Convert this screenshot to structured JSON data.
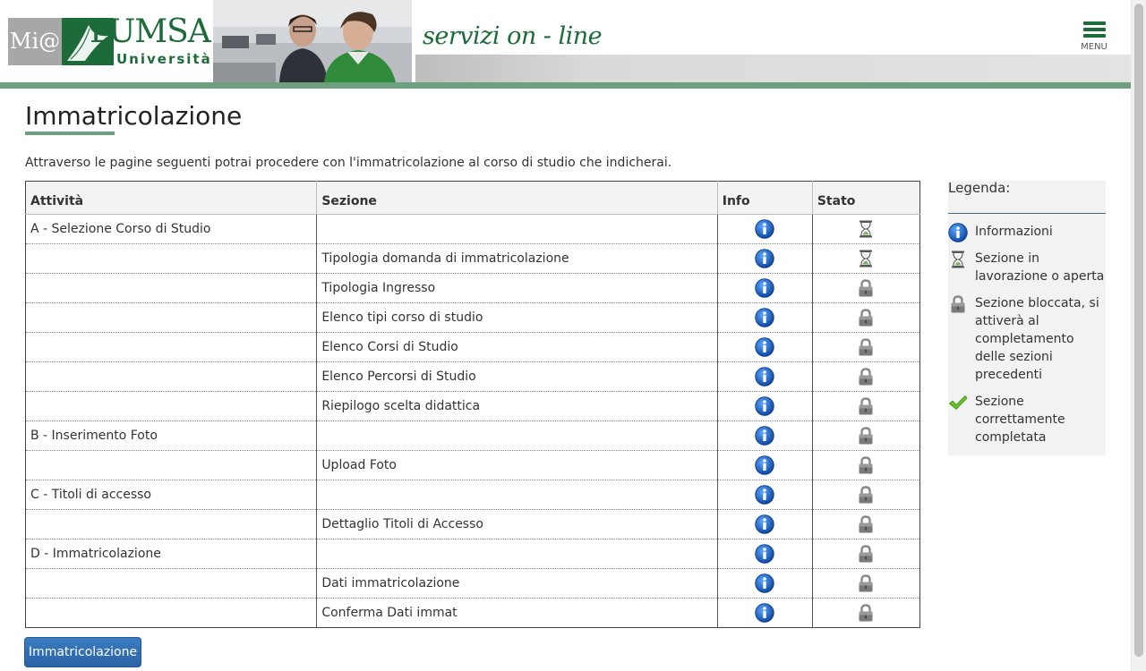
{
  "header": {
    "logo_mi": "Mi@",
    "logo_lumsa": "LUMSA",
    "logo_universita": "Università",
    "tagline": "servizi on - line",
    "menu_label": "MENU"
  },
  "main": {
    "title": "Immatricolazione",
    "intro": "Attraverso le pagine seguenti potrai procedere con l'immatricolazione al corso di studio che indicherai.",
    "table": {
      "headers": [
        "Attività",
        "Sezione",
        "Info",
        "Stato"
      ],
      "rows": [
        {
          "attivita": "A - Selezione Corso di Studio",
          "sezione": "",
          "info": "info-icon",
          "stato": "hourglass"
        },
        {
          "attivita": "",
          "sezione": "Tipologia domanda di immatricolazione",
          "info": "info-icon",
          "stato": "hourglass"
        },
        {
          "attivita": "",
          "sezione": "Tipologia Ingresso",
          "info": "info-icon",
          "stato": "lock"
        },
        {
          "attivita": "",
          "sezione": "Elenco tipi corso di studio",
          "info": "info-icon",
          "stato": "lock"
        },
        {
          "attivita": "",
          "sezione": "Elenco Corsi di Studio",
          "info": "info-icon",
          "stato": "lock"
        },
        {
          "attivita": "",
          "sezione": "Elenco Percorsi di Studio",
          "info": "info-icon",
          "stato": "lock"
        },
        {
          "attivita": "",
          "sezione": "Riepilogo scelta didattica",
          "info": "info-icon",
          "stato": "lock"
        },
        {
          "attivita": "B - Inserimento Foto",
          "sezione": "",
          "info": "info-icon",
          "stato": "lock"
        },
        {
          "attivita": "",
          "sezione": "Upload Foto",
          "info": "info-icon",
          "stato": "lock"
        },
        {
          "attivita": "C - Titoli di accesso",
          "sezione": "",
          "info": "info-icon",
          "stato": "lock"
        },
        {
          "attivita": "",
          "sezione": "Dettaglio Titoli di Accesso",
          "info": "info-icon",
          "stato": "lock"
        },
        {
          "attivita": "D - Immatricolazione",
          "sezione": "",
          "info": "info-icon",
          "stato": "lock"
        },
        {
          "attivita": "",
          "sezione": "Dati immatricolazione",
          "info": "info-icon",
          "stato": "lock"
        },
        {
          "attivita": "",
          "sezione": "Conferma Dati immat",
          "info": "info-icon",
          "stato": "lock"
        }
      ]
    },
    "button_label": "Immatricolazione"
  },
  "legend": {
    "title": "Legenda:",
    "items": [
      {
        "icon": "info-icon",
        "label": "Informazioni"
      },
      {
        "icon": "hourglass-icon",
        "label": "Sezione in lavorazione o aperta"
      },
      {
        "icon": "lock-icon",
        "label": "Sezione bloccata, si attiverà al completamento delle sezioni precedenti"
      },
      {
        "icon": "checkmark-icon",
        "label": "Sezione correttamente completata"
      }
    ]
  },
  "colors": {
    "brand_green": "#1e6b3a",
    "header_line": "#6e9f7f",
    "info_blue": "#1a5fb4",
    "button_blue": "#2f6eb3"
  }
}
